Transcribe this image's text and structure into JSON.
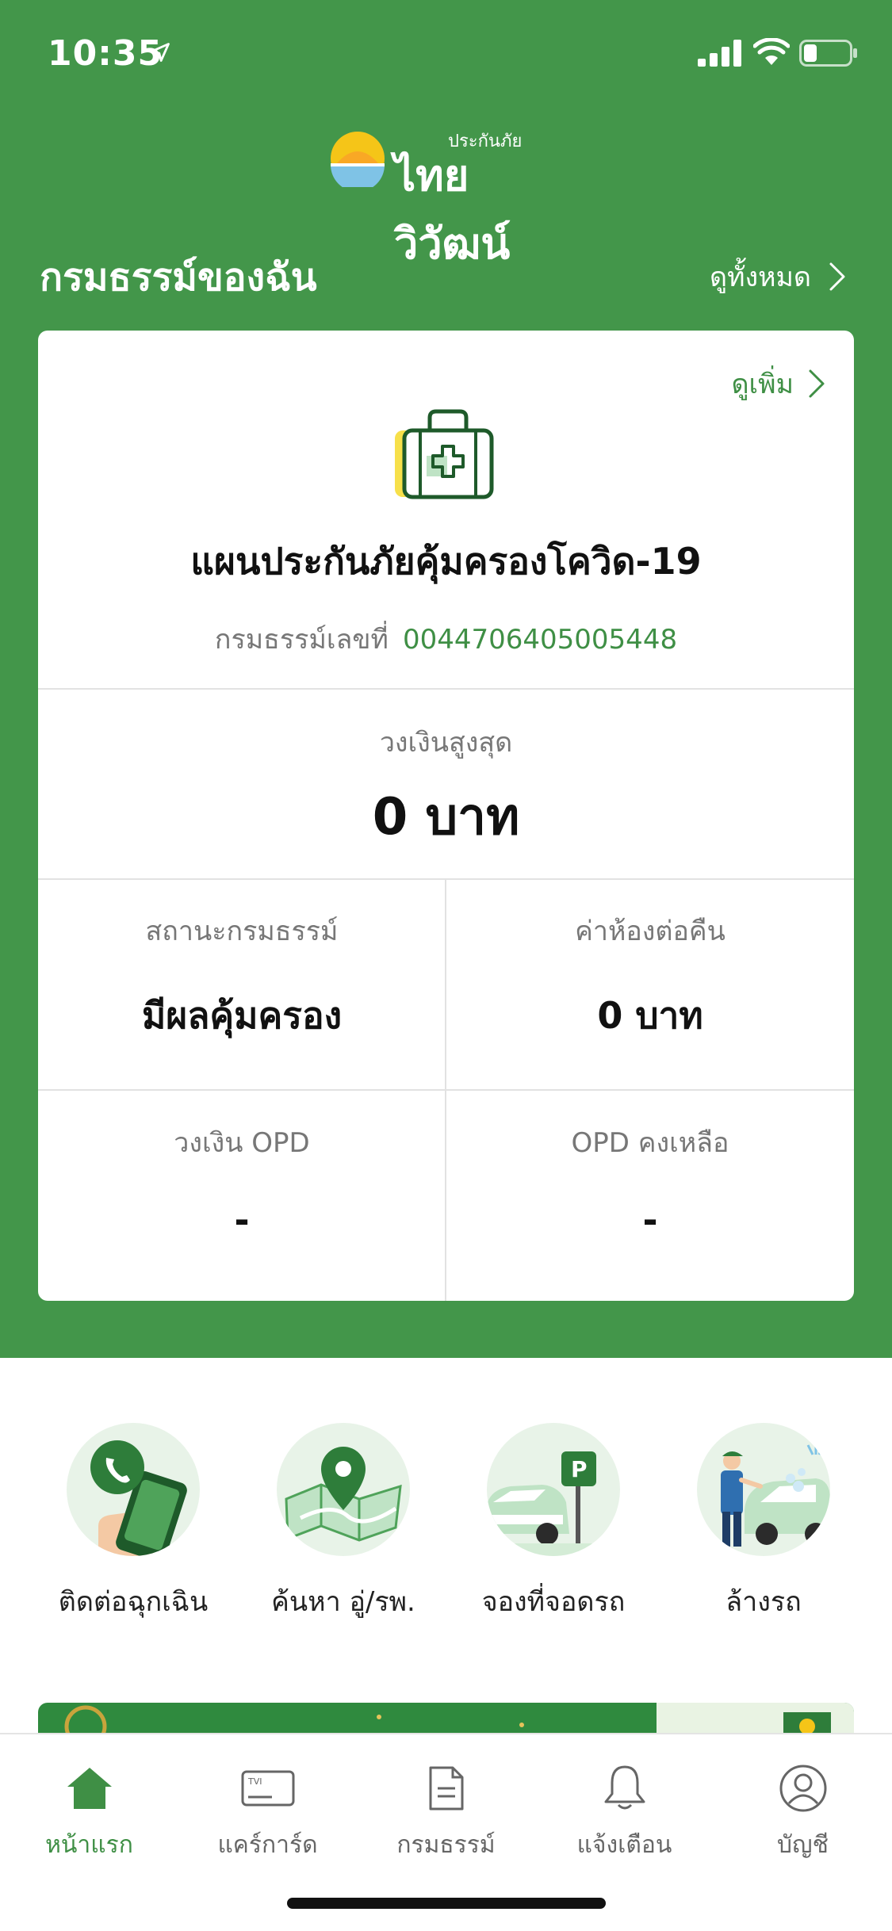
{
  "status_bar": {
    "time": "10:35"
  },
  "logo": {
    "sub": "ประกันภัย",
    "main": "ไทยวิวัฒน์"
  },
  "policies": {
    "title": "กรมธรรม์ของฉัน",
    "view_all": "ดูทั้งหมด"
  },
  "card": {
    "see_more": "ดูเพิ่ม",
    "plan_name": "แผนประกันภัยคุ้มครองโควิด-19",
    "policy_label": "กรมธรรม์เลขที่",
    "policy_number": "0044706405005448",
    "max_coverage_label": "วงเงินสูงสุด",
    "max_coverage_value": "0 บาท",
    "status_label": "สถานะกรมธรรม์",
    "status_value": "มีผลคุ้มครอง",
    "room_label": "ค่าห้องต่อคืน",
    "room_value": "0 บาท",
    "opd_label": "วงเงิน OPD",
    "opd_value": "-",
    "opd_remaining_label": "OPD คงเหลือ",
    "opd_remaining_value": "-"
  },
  "quick_actions": [
    {
      "label": "ติดต่อฉุกเฉิน",
      "icon": "emergency-phone-icon"
    },
    {
      "label": "ค้นหา อู่/รพ.",
      "icon": "map-pin-icon"
    },
    {
      "label": "จองที่จอดรถ",
      "icon": "parking-icon"
    },
    {
      "label": "ล้างรถ",
      "icon": "car-wash-icon"
    }
  ],
  "tabs": [
    {
      "label": "หน้าแรก",
      "icon": "home-icon",
      "active": true
    },
    {
      "label": "แคร์การ์ด",
      "icon": "card-icon",
      "card_text": "TVI"
    },
    {
      "label": "กรมธรรม์",
      "icon": "document-icon"
    },
    {
      "label": "แจ้งเตือน",
      "icon": "bell-icon"
    },
    {
      "label": "บัญชี",
      "icon": "account-icon"
    }
  ],
  "colors": {
    "primary_green": "#43964a",
    "accent_green": "#3f8f45",
    "light_green": "#e8f3e8"
  }
}
